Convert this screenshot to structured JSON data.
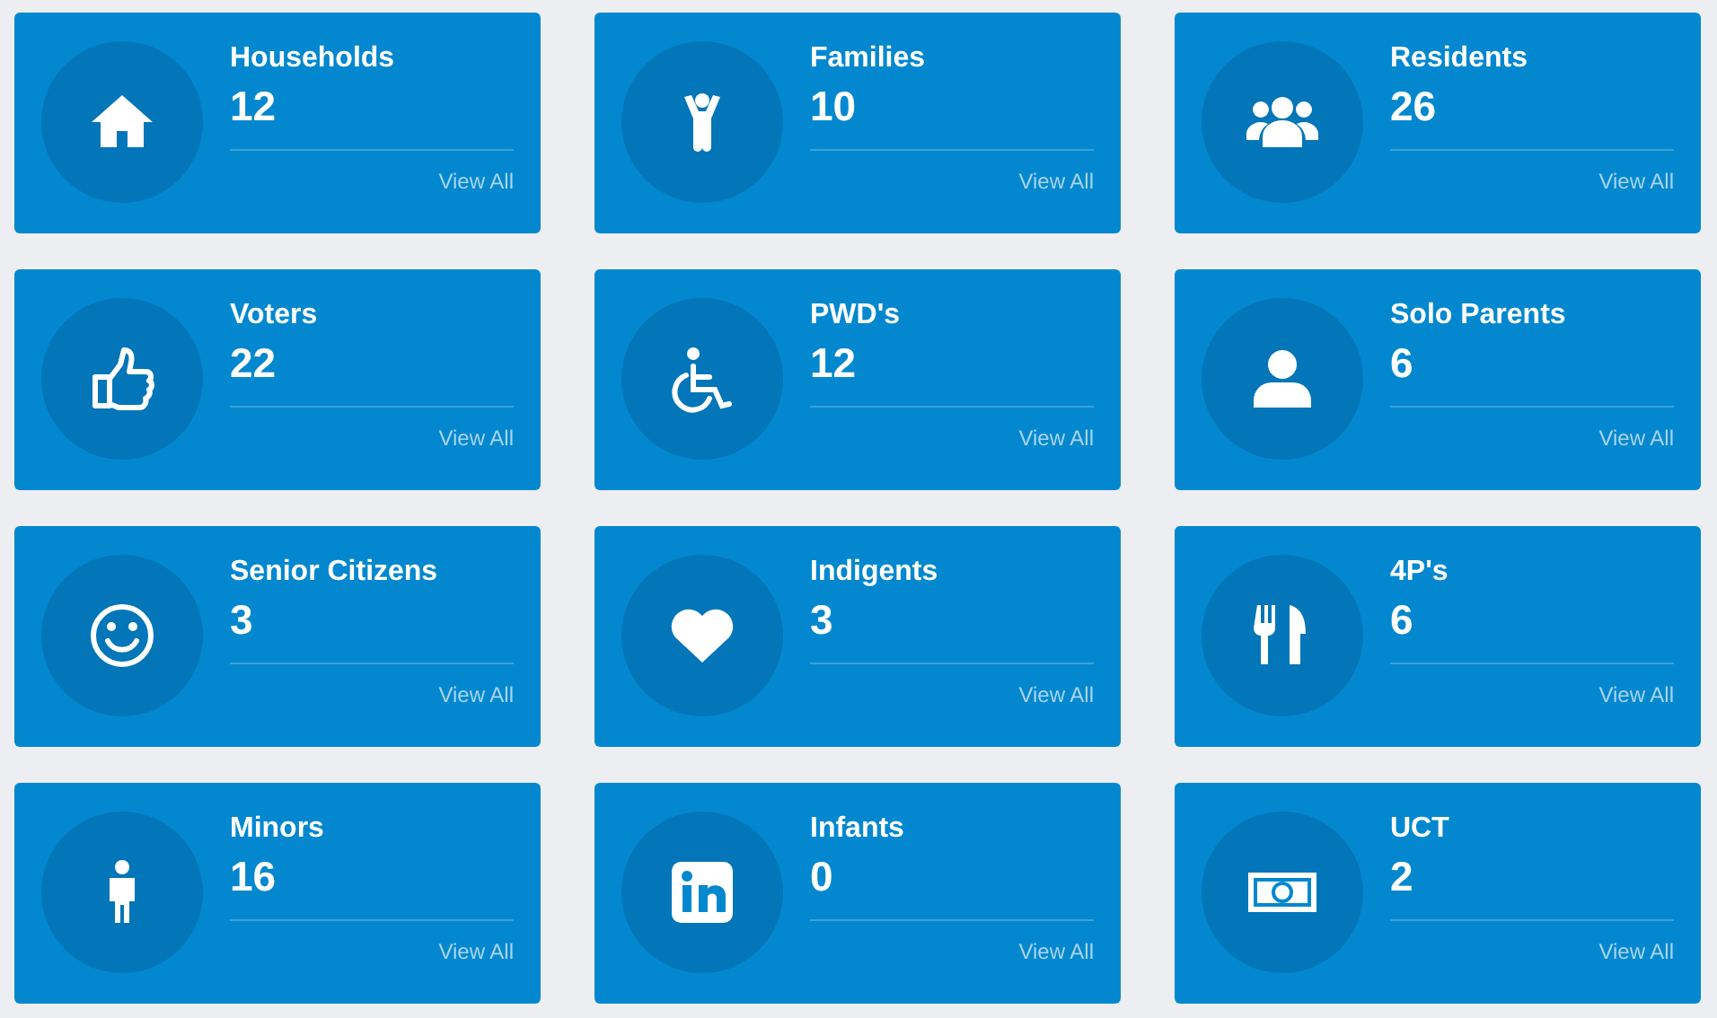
{
  "cards": [
    {
      "title": "Households",
      "count": "12",
      "link": "View All"
    },
    {
      "title": "Families",
      "count": "10",
      "link": "View All"
    },
    {
      "title": "Residents",
      "count": "26",
      "link": "View All"
    },
    {
      "title": "Voters",
      "count": "22",
      "link": "View All"
    },
    {
      "title": "PWD's",
      "count": "12",
      "link": "View All"
    },
    {
      "title": "Solo Parents",
      "count": "6",
      "link": "View All"
    },
    {
      "title": "Senior Citizens",
      "count": "3",
      "link": "View All"
    },
    {
      "title": "Indigents",
      "count": "3",
      "link": "View All"
    },
    {
      "title": "4P's",
      "count": "6",
      "link": "View All"
    },
    {
      "title": "Minors",
      "count": "16",
      "link": "View All"
    },
    {
      "title": "Infants",
      "count": "0",
      "link": "View All"
    },
    {
      "title": "UCT",
      "count": "2",
      "link": "View All"
    }
  ]
}
